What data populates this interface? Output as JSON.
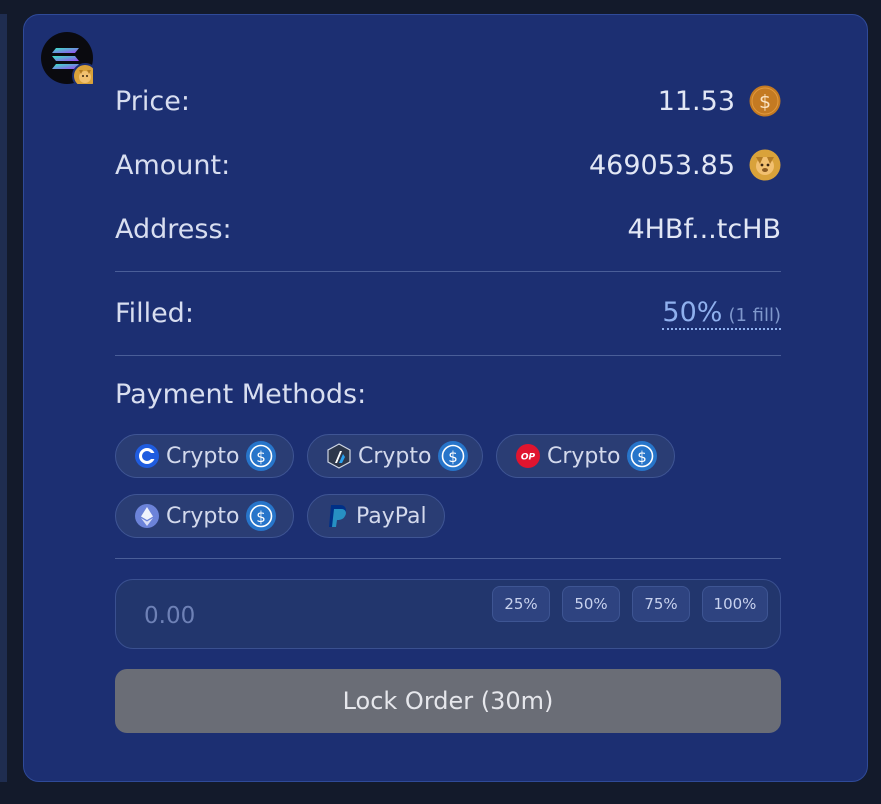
{
  "order": {
    "price_label": "Price:",
    "price_value": "11.53",
    "price_coin_icon": "usd-coin-orange-icon",
    "amount_label": "Amount:",
    "amount_value": "469053.85",
    "amount_coin_icon": "dog-token-icon",
    "address_label": "Address:",
    "address_value": "4HBf...tcHB",
    "filled_label": "Filled:",
    "filled_percent": "50%",
    "filled_count": "(1 fill)"
  },
  "chain": {
    "icon": "solana-icon",
    "token_icon": "dog-token-icon"
  },
  "payment": {
    "title": "Payment Methods:",
    "methods": [
      {
        "label": "Crypto",
        "network_icon": "coinbase-base-icon",
        "token_icon": "usdc-icon"
      },
      {
        "label": "Crypto",
        "network_icon": "arbitrum-icon",
        "token_icon": "usdc-icon"
      },
      {
        "label": "Crypto",
        "network_icon": "optimism-icon",
        "token_icon": "usdc-icon"
      },
      {
        "label": "Crypto",
        "network_icon": "ethereum-icon",
        "token_icon": "usdc-icon"
      },
      {
        "label": "PayPal",
        "network_icon": "paypal-icon"
      }
    ]
  },
  "amount_input": {
    "placeholder": "0.00",
    "presets": [
      "25%",
      "50%",
      "75%",
      "100%"
    ]
  },
  "action": {
    "lock_label": "Lock Order (30m)"
  },
  "colors": {
    "card_bg": "#1c2f72",
    "page_bg": "#131a2b",
    "link": "#8fb0ee",
    "button_disabled": "#6a6d76",
    "usd_coin": "#c47a22",
    "usdc": "#2775ca"
  }
}
